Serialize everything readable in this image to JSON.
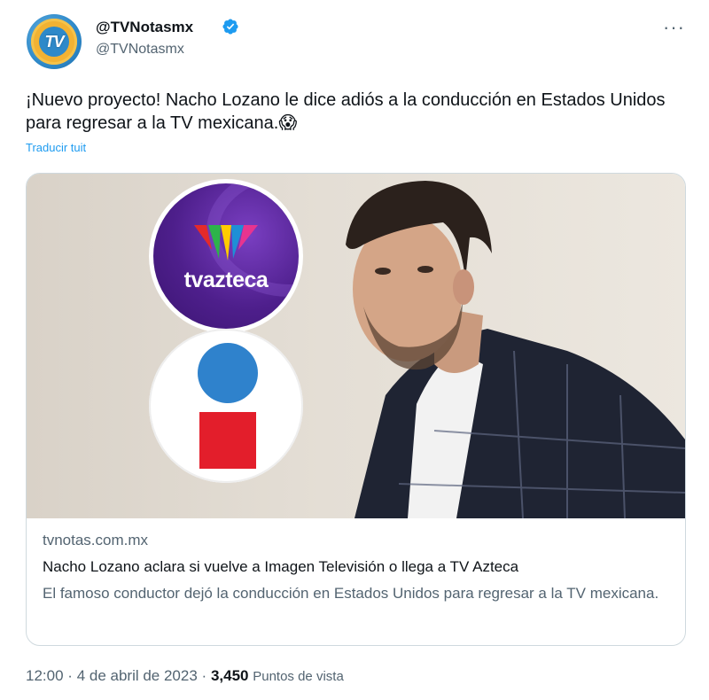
{
  "author": {
    "display_name": "@TVNotasmx",
    "handle": "@TVNotasmx",
    "avatar_text": "TV"
  },
  "tweet": {
    "text": "¡Nuevo proyecto! Nacho Lozano le dice adiós a la conducción en Estados Unidos para regresar a la TV mexicana.😱",
    "translate_label": "Traducir tuit"
  },
  "card": {
    "logo_brand": "tvazteca",
    "domain": "tvnotas.com.mx",
    "title": "Nacho Lozano aclara si vuelve a Imagen Televisión o llega a TV Azteca",
    "description": "El famoso conductor dejó la conducción en Estados Unidos para regresar a la TV mexicana."
  },
  "footer": {
    "time": "12:00",
    "separator": "·",
    "date": "4 de abril de 2023",
    "views_count": "3,450",
    "views_label": "Puntos de vista"
  },
  "icons": {
    "verified": "verified-badge-icon",
    "more": "more-options-icon"
  },
  "colors": {
    "accent": "#1d9bf0",
    "text": "#0f1419",
    "muted": "#536471",
    "border": "#cfd9de"
  }
}
